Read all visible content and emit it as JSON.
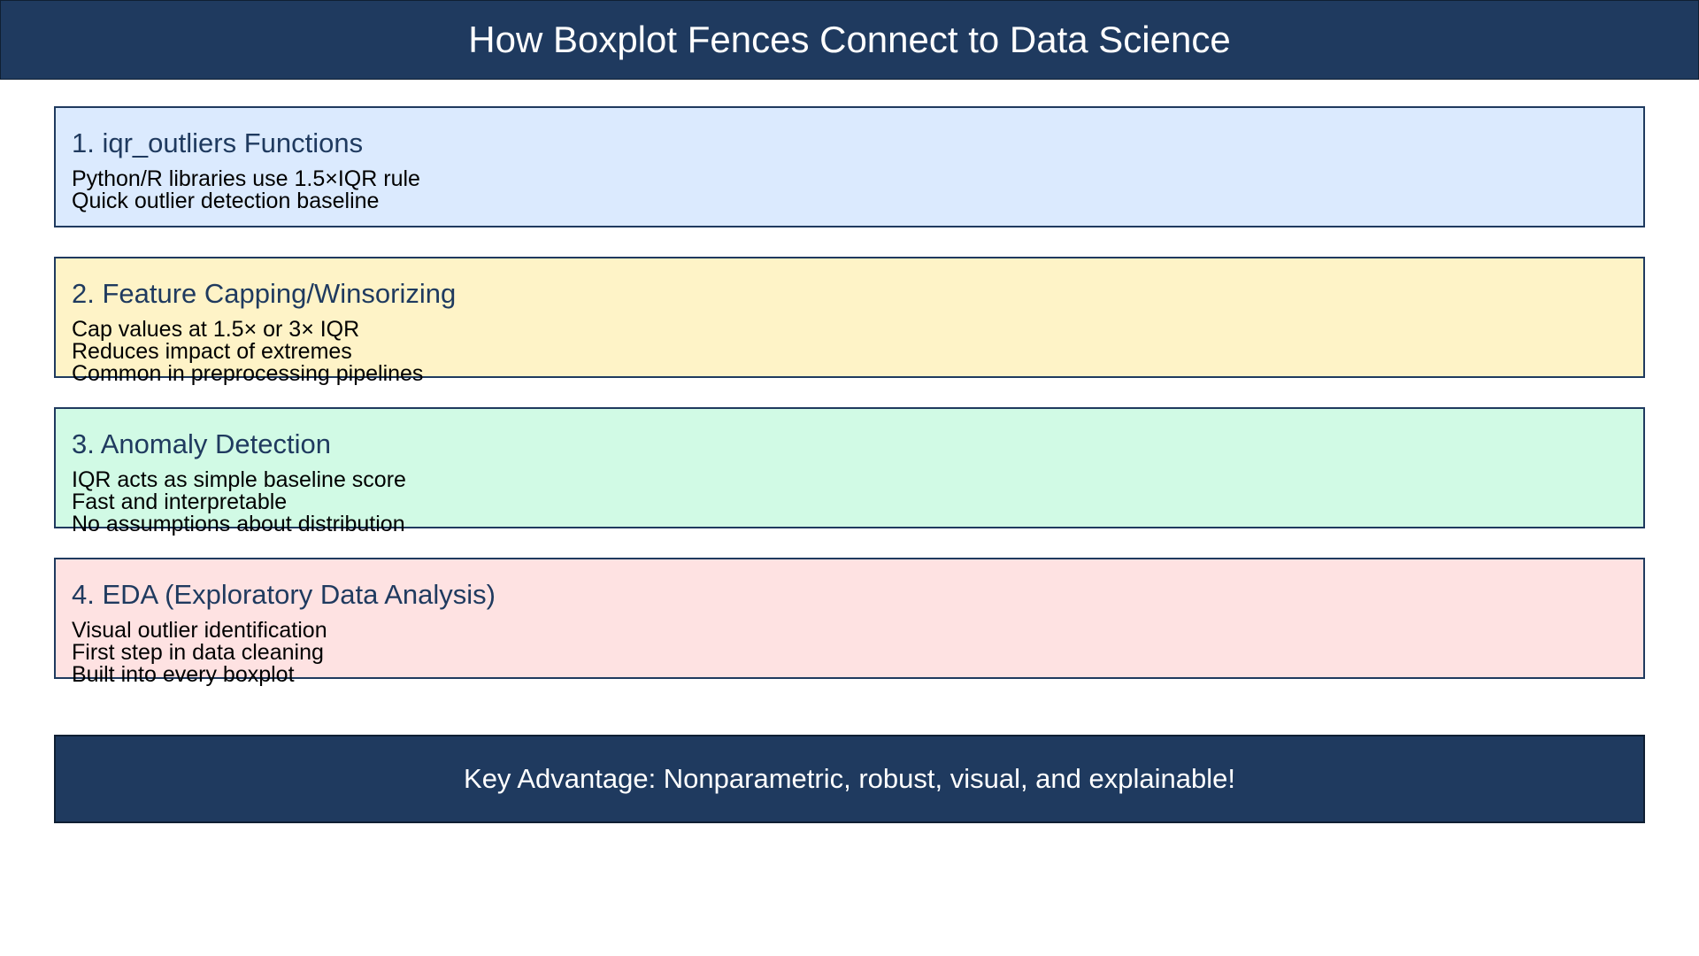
{
  "header": {
    "title": "How Boxplot Fences Connect to Data Science",
    "bg_color": "#1f3a5f"
  },
  "cards": [
    {
      "title": "1. iqr_outliers Functions",
      "bg_color": "#dbeafe",
      "lines": [
        "Python/R libraries use 1.5×IQR rule",
        "Quick outlier detection baseline"
      ]
    },
    {
      "title": "2. Feature Capping/Winsorizing",
      "bg_color": "#fef3c7",
      "lines": [
        "Cap values at 1.5× or 3× IQR",
        "Reduces impact of extremes",
        "Common in preprocessing pipelines"
      ]
    },
    {
      "title": "3. Anomaly Detection",
      "bg_color": "#d1fae5",
      "lines": [
        "IQR acts as simple baseline score",
        "Fast and interpretable",
        "No assumptions about distribution"
      ]
    },
    {
      "title": "4. EDA (Exploratory Data Analysis)",
      "bg_color": "#fee2e2",
      "lines": [
        "Visual outlier identification",
        "First step in data cleaning",
        "Built into every boxplot"
      ]
    }
  ],
  "footer": {
    "text": "Key Advantage: Nonparametric, robust, visual, and explainable!",
    "bg_color": "#1f3a5f"
  }
}
